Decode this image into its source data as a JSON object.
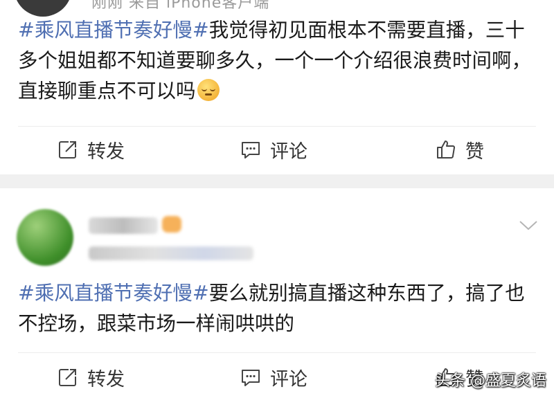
{
  "post1": {
    "meta": "刚刚  来自 iPhone客户端",
    "topic": "#乘风直播节奏好慢#",
    "text": "我觉得初见面根本不需要直播，三十多个姐姐都不知道要聊多久，一个一个介绍很浪费时间啊，直接聊重点不可以吗",
    "emoji": "sleepy-face-emoji"
  },
  "post2": {
    "topic": "#乘风直播节奏好慢#",
    "text": "要么就别搞直播这种东西了，搞了也不控场，跟菜市场一样闹哄哄的"
  },
  "actions": {
    "repost_label": "转发",
    "comment_label": "评论",
    "like_label": "赞"
  },
  "icons": {
    "repost": "repost-icon",
    "comment": "comment-icon",
    "like": "thumbs-up-icon",
    "more": "chevron-down-icon"
  },
  "colors": {
    "topic": "#4f6fb2",
    "separator": "#f0f0f0"
  },
  "watermark": "头条 @盛夏炙语"
}
